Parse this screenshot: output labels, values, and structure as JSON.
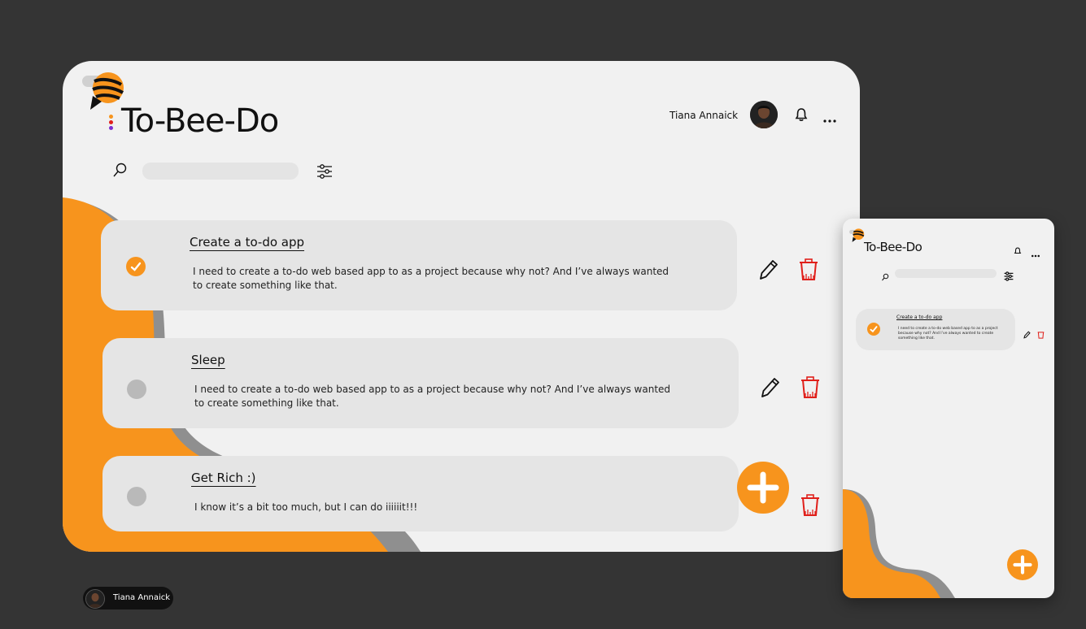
{
  "app": {
    "name": "To-Bee-Do"
  },
  "user": {
    "name": "Tiana Annaick"
  },
  "colors": {
    "accent": "#f7941d",
    "delete": "#e0201b",
    "background": "#343434",
    "card": "#f1f1f1"
  },
  "tasks": [
    {
      "title": "Create a to-do app",
      "description": "I need to create a to-do web based app to as a project because why not? And I’ve always wanted to create something like that.",
      "done": true
    },
    {
      "title": "Sleep",
      "description": "I need to create a to-do web based app to as a project because why not? And I’ve always wanted to create something like that.",
      "done": false
    },
    {
      "title": "Get Rich :)",
      "description": "I know it’s a bit too much, but I can do iiiiiit!!!",
      "done": false
    }
  ],
  "mobile": {
    "task": {
      "title": "Create a to-do app",
      "description": "I need to create a to-do web based app to as a project because why not? And I’ve always wanted to create something like that.",
      "done": true
    }
  },
  "icons": [
    "bee-logo-icon",
    "bell-icon",
    "more-icon",
    "search-icon",
    "filter-icon",
    "check-icon",
    "pencil-icon",
    "trash-icon",
    "plus-icon"
  ]
}
